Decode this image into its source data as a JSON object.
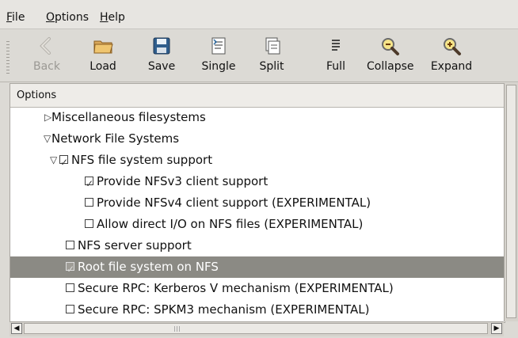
{
  "menu": [
    {
      "label": "File",
      "mnemonic": "F",
      "rest": "ile"
    },
    {
      "label": "Options",
      "mnemonic": "O",
      "rest": "ptions"
    },
    {
      "label": "Help",
      "mnemonic": "H",
      "rest": "elp"
    }
  ],
  "toolbar": {
    "items": [
      {
        "label": "Back",
        "icon": "back-arrow-icon",
        "enabled": false
      },
      {
        "label": "Load",
        "icon": "folder-icon",
        "enabled": true
      },
      {
        "label": "Save",
        "icon": "floppy-disk-icon",
        "enabled": true
      },
      {
        "label": "Single",
        "icon": "single-view-icon",
        "enabled": true
      },
      {
        "label": "Split",
        "icon": "split-view-icon",
        "enabled": true
      },
      {
        "label": "Full",
        "icon": "full-view-icon",
        "enabled": true
      },
      {
        "label": "Collapse",
        "icon": "zoom-out-icon",
        "enabled": true
      },
      {
        "label": "Expand",
        "icon": "zoom-in-icon",
        "enabled": true
      }
    ]
  },
  "tree": {
    "header": "Options",
    "rows": [
      {
        "text": "Miscellaneous filesystems",
        "expander": "collapsed"
      },
      {
        "text": "Network File Systems",
        "expander": "expanded"
      },
      {
        "text": "NFS file system support",
        "checked": true,
        "expander": "expanded"
      },
      {
        "text": "Provide NFSv3 client support",
        "checked": true
      },
      {
        "text": "Provide NFSv4 client support (EXPERIMENTAL)",
        "checked": false
      },
      {
        "text": "Allow direct I/O on NFS files (EXPERIMENTAL)",
        "checked": false
      },
      {
        "text": "NFS server support",
        "checked": false
      },
      {
        "text": "Root file system on NFS",
        "checked": true,
        "selected": true
      },
      {
        "text": "Secure RPC: Kerberos V mechanism (EXPERIMENTAL)",
        "checked": false
      },
      {
        "text": "Secure RPC: SPKM3 mechanism (EXPERIMENTAL)",
        "checked": false
      }
    ]
  },
  "colors": {
    "selection": "#8b8a84",
    "window": "#dcdad5"
  }
}
